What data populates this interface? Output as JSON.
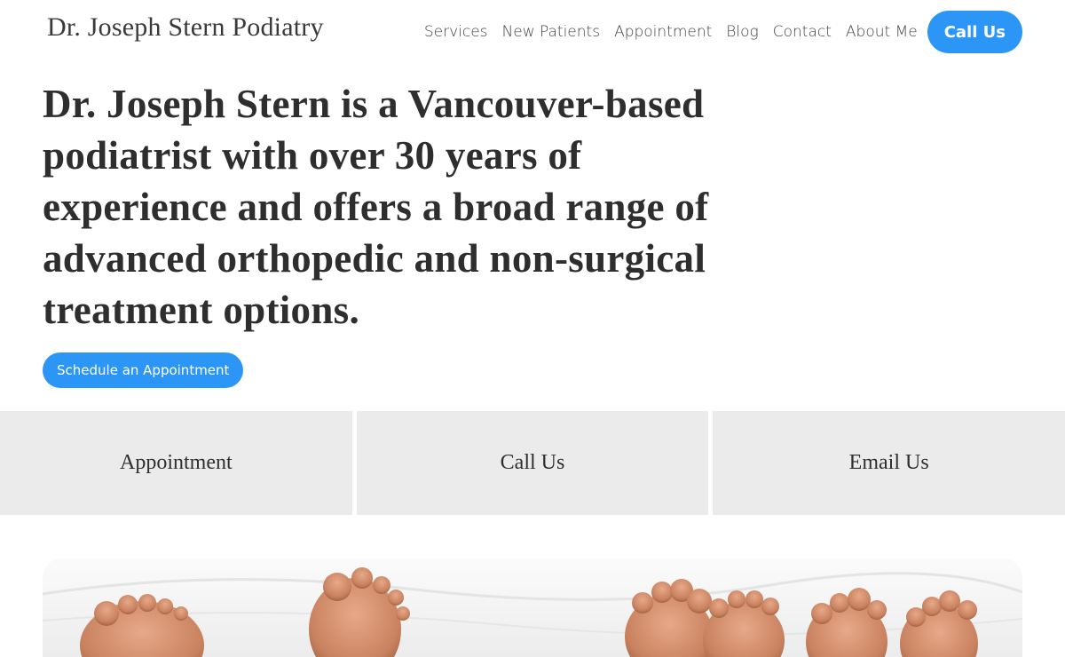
{
  "header": {
    "logo": "Dr. Joseph Stern Podiatry",
    "nav": [
      {
        "label": "Services"
      },
      {
        "label": "New Patients"
      },
      {
        "label": "Appointment"
      },
      {
        "label": "Blog"
      },
      {
        "label": "Contact"
      },
      {
        "label": "About Me"
      }
    ],
    "call_button": "Call Us"
  },
  "hero": {
    "heading": "Dr. Joseph Stern is a Vancouver-based podiatrist with over 30 years of experience and offers a broad range of advanced orthopedic and non-surgical treatment options.",
    "cta": "Schedule an Appointment"
  },
  "tiles": [
    {
      "label": "Appointment"
    },
    {
      "label": "Call Us"
    },
    {
      "label": "Email Us"
    }
  ],
  "colors": {
    "accent": "#2b96f5",
    "tile_background": "#ebebeb",
    "text": "#2e2e2e"
  },
  "photo": {
    "icon": "bare-feet-photo"
  }
}
